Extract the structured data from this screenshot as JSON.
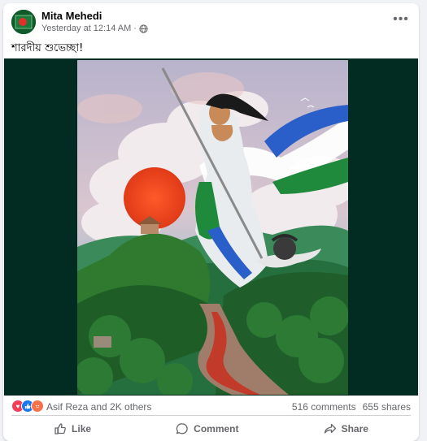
{
  "post": {
    "author": "Mita Mehedi",
    "timestamp": "Yesterday at 12:14 AM",
    "separator": "·",
    "privacy_icon": "globe-icon",
    "caption": "শারদীয় শুভেচ্ছা!",
    "more_icon": "more-horizontal-icon",
    "more_label": "•••"
  },
  "reactions": {
    "icons": [
      "love-icon",
      "like-icon",
      "angry-icon"
    ],
    "summary": "Asif Reza and 2K others",
    "comments": "516 comments",
    "shares": "655 shares"
  },
  "actions": {
    "like_label": "Like",
    "comment_label": "Comment",
    "share_label": "Share"
  },
  "colors": {
    "media_background": "#022b21",
    "accent_blue": "#1877f2",
    "love_red": "#f33e58",
    "angry_orange": "#f7714b"
  }
}
